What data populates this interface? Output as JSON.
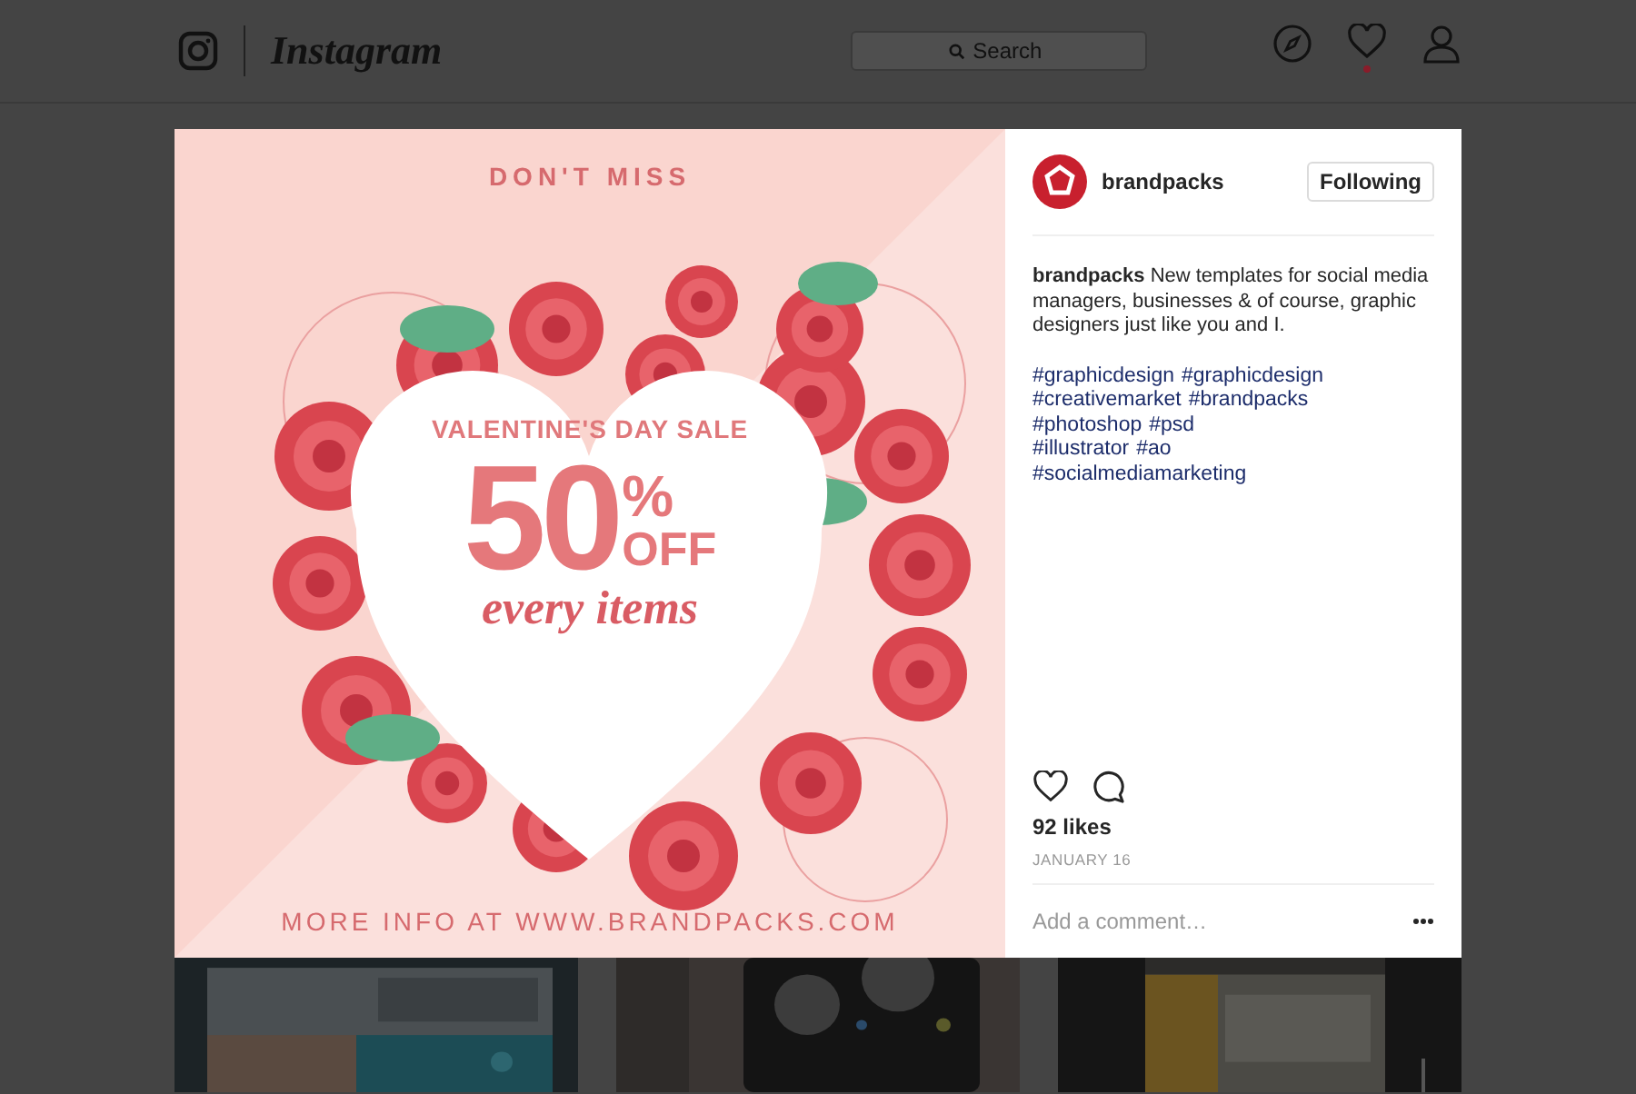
{
  "header": {
    "logo": "Instagram",
    "search": {
      "placeholder": "Search"
    },
    "activity_dot": true
  },
  "post": {
    "image": {
      "kind": "picture",
      "headline": "DON'T MISS",
      "title": "VALENTINE'S DAY SALE",
      "big": "50",
      "percent": "%",
      "off": "OFF",
      "script": "every items",
      "footer": "MORE INFO AT WWW.BRANDPACKS.COM"
    },
    "author": {
      "username": "brandpacks",
      "button": "Following"
    },
    "caption": {
      "username": "brandpacks",
      "text": "New templates for social media managers, businesses & of course, graphic designers just like you and I."
    },
    "hashtag_lines": [
      [
        "#graphicdesign",
        "#graphicdesign"
      ],
      [
        "#creativemarket",
        "#brandpacks"
      ],
      [
        "#photoshop",
        "#psd"
      ],
      [
        "#illustrator",
        "#ao"
      ],
      [
        "#socialmediamarketing"
      ]
    ],
    "liked": false,
    "likes": "92 likes",
    "date": "JANUARY 16",
    "comment": {
      "placeholder": "Add a comment…"
    }
  }
}
